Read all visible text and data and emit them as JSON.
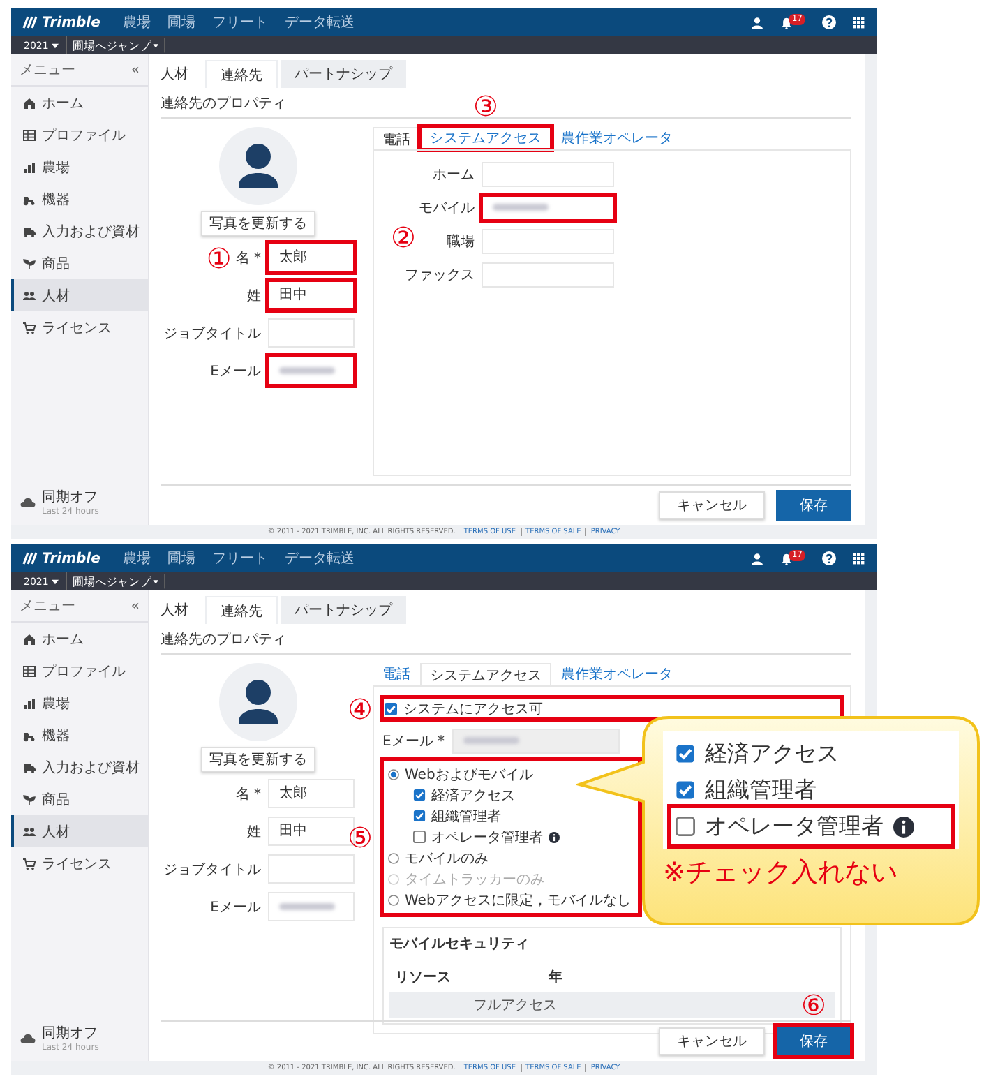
{
  "screens": [
    {
      "header": {
        "logo": "Trimble",
        "nav": [
          "農場",
          "圃場",
          "フリート",
          "データ転送"
        ],
        "badge": "17"
      },
      "subbar": [
        "2021",
        "圃場へジャンプ"
      ],
      "sidebar": {
        "title": "メニュー",
        "collapse": "«",
        "items": [
          {
            "label": "ホーム",
            "selected": false
          },
          {
            "label": "プロファイル",
            "selected": false
          },
          {
            "label": "農場",
            "selected": false
          },
          {
            "label": "機器",
            "selected": false
          },
          {
            "label": "入力および資材",
            "selected": false
          },
          {
            "label": "商品",
            "selected": false
          },
          {
            "label": "人材",
            "selected": true
          },
          {
            "label": "ライセンス",
            "selected": false
          }
        ],
        "sync": {
          "label": "同期オフ",
          "detail": "Last 24 hours"
        }
      },
      "breadcrumb": "人材",
      "tabs": [
        {
          "label": "連絡先",
          "selected": true
        },
        {
          "label": "パートナシップ",
          "selected": false
        }
      ],
      "heading": "連絡先のプロパティ",
      "photo_button": "写真を更新する",
      "fields": [
        {
          "label": "名 *",
          "value": "太郎",
          "highlighted": true,
          "marker": "①"
        },
        {
          "label": "姓",
          "value": "田中",
          "highlighted": true
        },
        {
          "label": "ジョブタイトル",
          "highlighted": false
        },
        {
          "label": "Eメール",
          "redacted": true,
          "highlighted": true
        }
      ],
      "detail_tabs": [
        {
          "label": "電話",
          "selected": true,
          "highlighted": false
        },
        {
          "label": "システムアクセス",
          "selected": false,
          "highlighted": true,
          "marker": "③"
        },
        {
          "label": "農作業オペレータ",
          "selected": false,
          "highlighted": false
        }
      ],
      "detail": {
        "kind": "phone",
        "fields": [
          {
            "label": "ホーム",
            "highlighted": false
          },
          {
            "label": "モバイル",
            "redacted": true,
            "highlighted": true,
            "marker": "②"
          },
          {
            "label": "職場",
            "highlighted": false
          },
          {
            "label": "ファックス",
            "highlighted": false
          }
        ]
      },
      "buttons": [
        {
          "label": "キャンセル",
          "kind": "secondary",
          "highlighted": false
        },
        {
          "label": "保存",
          "kind": "primary",
          "highlighted": false
        }
      ],
      "footer": {
        "copyright": "© 2011 - 2021 TRIMBLE, INC. ALL RIGHTS RESERVED.",
        "links": [
          "TERMS OF USE",
          "TERMS OF SALE",
          "PRIVACY"
        ]
      }
    },
    {
      "header": {
        "logo": "Trimble",
        "nav": [
          "農場",
          "圃場",
          "フリート",
          "データ転送"
        ],
        "badge": "17"
      },
      "subbar": [
        "2021",
        "圃場へジャンプ"
      ],
      "sidebar": {
        "title": "メニュー",
        "collapse": "«",
        "items": [
          {
            "label": "ホーム",
            "selected": false
          },
          {
            "label": "プロファイル",
            "selected": false
          },
          {
            "label": "農場",
            "selected": false
          },
          {
            "label": "機器",
            "selected": false
          },
          {
            "label": "入力および資材",
            "selected": false
          },
          {
            "label": "商品",
            "selected": false
          },
          {
            "label": "人材",
            "selected": true
          },
          {
            "label": "ライセンス",
            "selected": false
          }
        ],
        "sync": {
          "label": "同期オフ",
          "detail": "Last 24 hours"
        }
      },
      "breadcrumb": "人材",
      "tabs": [
        {
          "label": "連絡先",
          "selected": true
        },
        {
          "label": "パートナシップ",
          "selected": false
        }
      ],
      "heading": "連絡先のプロパティ",
      "photo_button": "写真を更新する",
      "fields": [
        {
          "label": "名 *",
          "value": "太郎",
          "highlighted": false
        },
        {
          "label": "姓",
          "value": "田中",
          "highlighted": false
        },
        {
          "label": "ジョブタイトル",
          "highlighted": false
        },
        {
          "label": "Eメール",
          "redacted": true,
          "highlighted": false
        }
      ],
      "detail_tabs": [
        {
          "label": "電話",
          "selected": false,
          "highlighted": false
        },
        {
          "label": "システムアクセス",
          "selected": true,
          "highlighted": false
        },
        {
          "label": "農作業オペレータ",
          "selected": false,
          "highlighted": false
        }
      ],
      "detail": {
        "kind": "access",
        "access": {
          "label": "システムにアクセス可",
          "checked": true,
          "highlighted": true,
          "marker": "④"
        },
        "email": {
          "label": "Eメール *",
          "redacted": true
        },
        "options_highlighted": true,
        "options_marker": "⑤",
        "options": [
          {
            "label": "Webおよびモバイル",
            "selected": true,
            "disabled": false,
            "children": [
              {
                "label": "経済アクセス",
                "checked": true,
                "info": false
              },
              {
                "label": "組織管理者",
                "checked": true,
                "info": false
              },
              {
                "label": "オペレータ管理者",
                "checked": false,
                "info": true
              }
            ]
          },
          {
            "label": "モバイルのみ",
            "selected": false,
            "disabled": false
          },
          {
            "label": "タイムトラッカーのみ",
            "selected": false,
            "disabled": true
          },
          {
            "label": "Webアクセスに限定，モバイルなし",
            "selected": false,
            "disabled": false
          }
        ],
        "security": {
          "title": "モバイルセキュリティ",
          "columns": [
            "リソース",
            "年"
          ],
          "row": "フルアクセス"
        }
      },
      "buttons": [
        {
          "label": "キャンセル",
          "kind": "secondary",
          "highlighted": false
        },
        {
          "label": "保存",
          "kind": "primary",
          "highlighted": true,
          "marker": "⑥"
        }
      ],
      "footer": {
        "copyright": "© 2011 - 2021 TRIMBLE, INC. ALL RIGHTS RESERVED.",
        "links": [
          "TERMS OF USE",
          "TERMS OF SALE",
          "PRIVACY"
        ]
      }
    }
  ],
  "callout": {
    "items": [
      {
        "label": "経済アクセス",
        "checked": true,
        "info": false,
        "highlighted": false
      },
      {
        "label": "組織管理者",
        "checked": true,
        "info": false,
        "highlighted": false
      },
      {
        "label": "オペレータ管理者",
        "checked": false,
        "info": true,
        "highlighted": true
      }
    ],
    "note": "※チェック入れない"
  }
}
